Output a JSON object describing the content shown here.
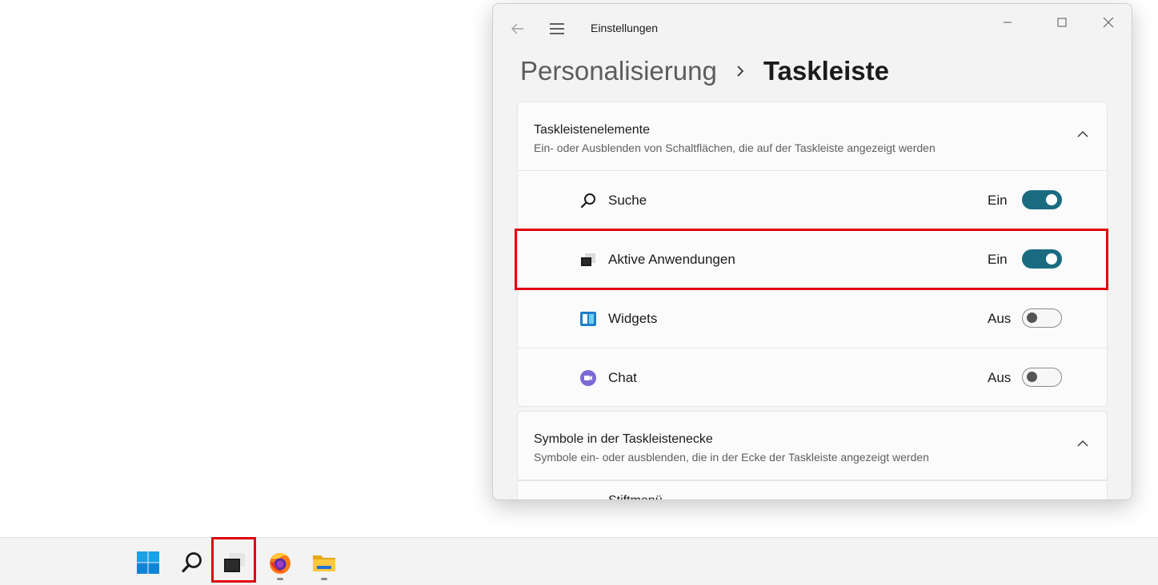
{
  "window": {
    "title": "Einstellungen"
  },
  "breadcrumb": {
    "parent": "Personalisierung",
    "current": "Taskleiste"
  },
  "section1": {
    "title": "Taskleistenelemente",
    "subtitle": "Ein- oder Ausblenden von Schaltflächen, die auf der Taskleiste angezeigt werden",
    "items": [
      {
        "label": "Suche",
        "state": "Ein",
        "on": true,
        "icon": "search-icon"
      },
      {
        "label": "Aktive Anwendungen",
        "state": "Ein",
        "on": true,
        "icon": "task-view-icon"
      },
      {
        "label": "Widgets",
        "state": "Aus",
        "on": false,
        "icon": "widgets-icon"
      },
      {
        "label": "Chat",
        "state": "Aus",
        "on": false,
        "icon": "chat-icon"
      }
    ]
  },
  "section2": {
    "title": "Symbole in der Taskleistenecke",
    "subtitle": "Symbole ein- oder ausblenden, die in der Ecke der Taskleiste angezeigt werden",
    "partial_item": "Stiftmenü"
  },
  "colors": {
    "accent": "#1a6b80",
    "highlight": "#e00010"
  },
  "taskbar": {
    "icons": [
      "windows-start-icon",
      "search-icon",
      "task-view-icon",
      "firefox-icon",
      "file-explorer-icon"
    ]
  }
}
